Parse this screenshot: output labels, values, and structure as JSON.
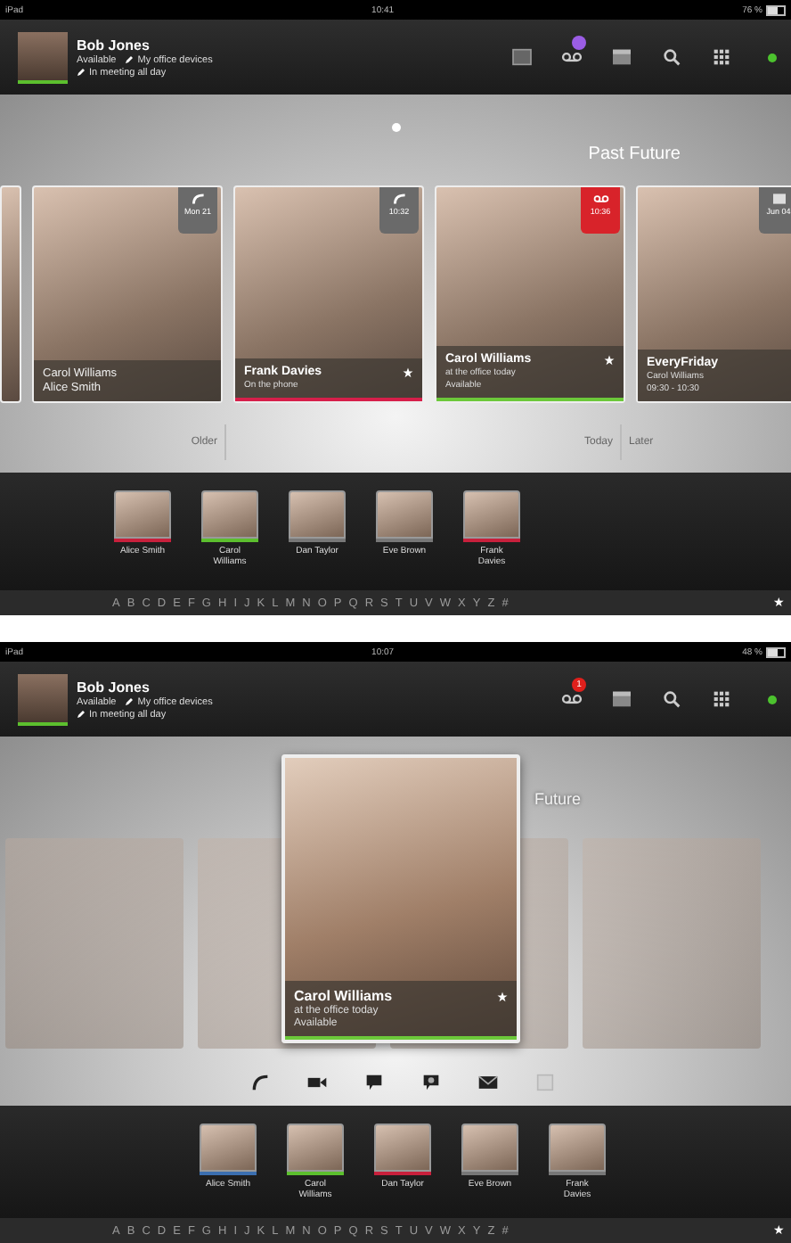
{
  "screens": [
    {
      "kind": "timeline",
      "status_bar": {
        "carrier": "iPad",
        "time": "10:41",
        "battery": "76 %"
      },
      "profile": {
        "name": "Bob Jones",
        "status": "Available",
        "devices": "My office devices",
        "note": "In meeting all day"
      },
      "toolbar": [
        {
          "kind": "display"
        },
        {
          "kind": "voicemail",
          "badge": {
            "color": "#9b5de5"
          }
        },
        {
          "kind": "calendar"
        },
        {
          "kind": "search"
        },
        {
          "kind": "grid"
        }
      ],
      "online": true,
      "heading": "Past Future",
      "cards": [
        {
          "kind": "group",
          "lines": [
            "Carol Williams",
            "Alice Smith"
          ],
          "tag": {
            "kind": "call",
            "text": "Mon 21",
            "alert": false
          }
        },
        {
          "kind": "contact",
          "title": "Frank Davies",
          "starred": true,
          "lines": [
            "On the phone"
          ],
          "tag": {
            "kind": "call",
            "text": "10:32",
            "alert": false
          },
          "color": "#d61f4a"
        },
        {
          "kind": "contact",
          "title": "Carol Williams",
          "starred": true,
          "lines": [
            "at the office today",
            "Available"
          ],
          "tag": {
            "kind": "voicemail",
            "text": "10:36",
            "alert": true
          },
          "color": "#6cc83a"
        },
        {
          "kind": "event",
          "title": "EveryFriday",
          "lines": [
            "Carol Williams",
            "09:30 - 10:30"
          ],
          "tag": {
            "kind": "calendar",
            "text": "Jun 04",
            "alert": false
          }
        }
      ],
      "timeline_labels": [
        "Older",
        "Today",
        "Later"
      ],
      "dock": [
        {
          "name": "Alice Smith",
          "color": "#c8203c"
        },
        {
          "name": "Carol Williams",
          "color": "#5cbf2e"
        },
        {
          "name": "Dan Taylor"
        },
        {
          "name": "Eve Brown"
        },
        {
          "name": "Frank Davies",
          "color": "#c8203c"
        }
      ],
      "alphabet": [
        "A",
        "B",
        "C",
        "D",
        "E",
        "F",
        "G",
        "H",
        "I",
        "J",
        "K",
        "L",
        "M",
        "N",
        "O",
        "P",
        "Q",
        "R",
        "S",
        "T",
        "U",
        "V",
        "W",
        "X",
        "Y",
        "Z",
        "#"
      ],
      "favorites": "★"
    },
    {
      "kind": "focus",
      "status_bar": {
        "carrier": "iPad",
        "time": "10:07",
        "battery": "48 %"
      },
      "profile": {
        "name": "Bob Jones",
        "status": "Available",
        "devices": "My office devices",
        "note": "In meeting all day"
      },
      "toolbar": [
        {
          "kind": "voicemail",
          "badge": {
            "color": "#e0201c",
            "count": "1"
          }
        },
        {
          "kind": "calendar"
        },
        {
          "kind": "search"
        },
        {
          "kind": "grid"
        }
      ],
      "online": true,
      "heading": "Future",
      "focus_card": {
        "title": "Carol Williams",
        "starred": true,
        "lines": [
          "at the office today",
          "Available"
        ],
        "color": "#6cc83a"
      },
      "actions": [
        {
          "kind": "phone",
          "disabled": false
        },
        {
          "kind": "video",
          "disabled": false
        },
        {
          "kind": "chat",
          "disabled": false
        },
        {
          "kind": "group-chat",
          "disabled": false
        },
        {
          "kind": "mail",
          "disabled": false
        },
        {
          "kind": "box",
          "disabled": true
        }
      ],
      "dock": [
        {
          "name": "Alice Smith",
          "color": "#3b6fb0"
        },
        {
          "name": "Carol Williams",
          "color": "#5cbf2e"
        },
        {
          "name": "Dan Taylor",
          "color": "#c8203c"
        },
        {
          "name": "Eve Brown"
        },
        {
          "name": "Frank Davies"
        }
      ],
      "alphabet": [
        "A",
        "B",
        "C",
        "D",
        "E",
        "F",
        "G",
        "H",
        "I",
        "J",
        "K",
        "L",
        "M",
        "N",
        "O",
        "P",
        "Q",
        "R",
        "S",
        "T",
        "U",
        "V",
        "W",
        "X",
        "Y",
        "Z",
        "#"
      ],
      "favorites": "★"
    }
  ]
}
